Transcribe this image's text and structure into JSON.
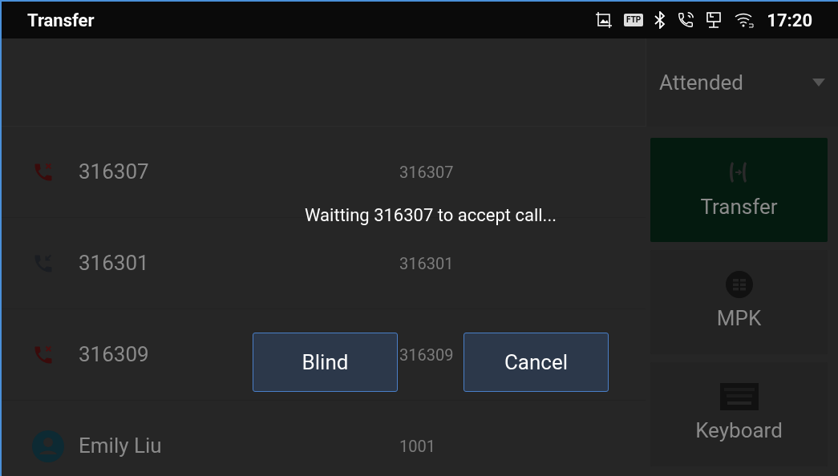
{
  "status_bar": {
    "title": "Transfer",
    "ftp": "FTP",
    "time": "17:20"
  },
  "transfer_mode": {
    "value": "Attended"
  },
  "calls": [
    {
      "name": "316307",
      "number": "316307",
      "kind": "missed"
    },
    {
      "name": "316301",
      "number": "316301",
      "kind": "incoming"
    },
    {
      "name": "316309",
      "number": "316309",
      "kind": "missed"
    },
    {
      "name": "Emily Liu",
      "number": "1001",
      "kind": "contact"
    }
  ],
  "actions": [
    {
      "label": "Transfer",
      "kind": "transfer",
      "selected": true
    },
    {
      "label": "MPK",
      "kind": "mpk",
      "selected": false
    },
    {
      "label": "Keyboard",
      "kind": "keyboard",
      "selected": false
    }
  ],
  "dialog": {
    "message": "Waitting 316307 to accept call...",
    "buttons": [
      "Blind",
      "Cancel"
    ]
  }
}
